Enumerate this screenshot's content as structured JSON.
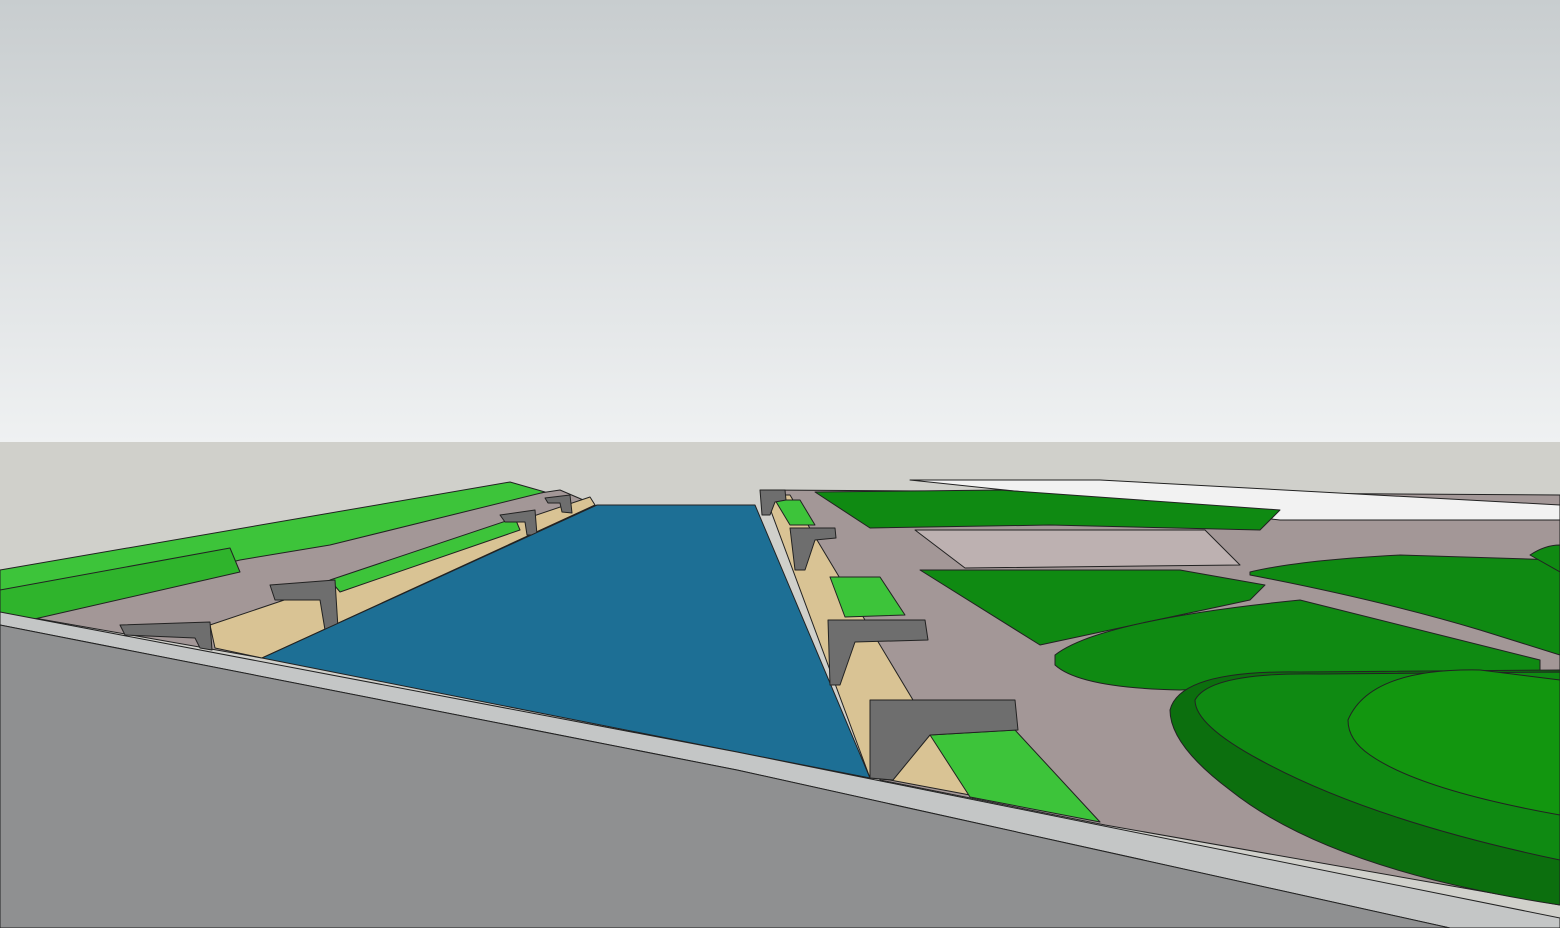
{
  "scene": {
    "colors": {
      "sky_top": "#c8cdcf",
      "sky_bottom": "#eff1f2",
      "ground": "#d0d0cb",
      "road": "#8f9091",
      "curb": "#c4c6c6",
      "water": "#1d6f95",
      "paving": "#a39797",
      "lawn_light": "#3dc43a",
      "lawn_dark": "#0f8a12",
      "timber": "#d9c394",
      "concrete": "#6e6e6e"
    }
  }
}
